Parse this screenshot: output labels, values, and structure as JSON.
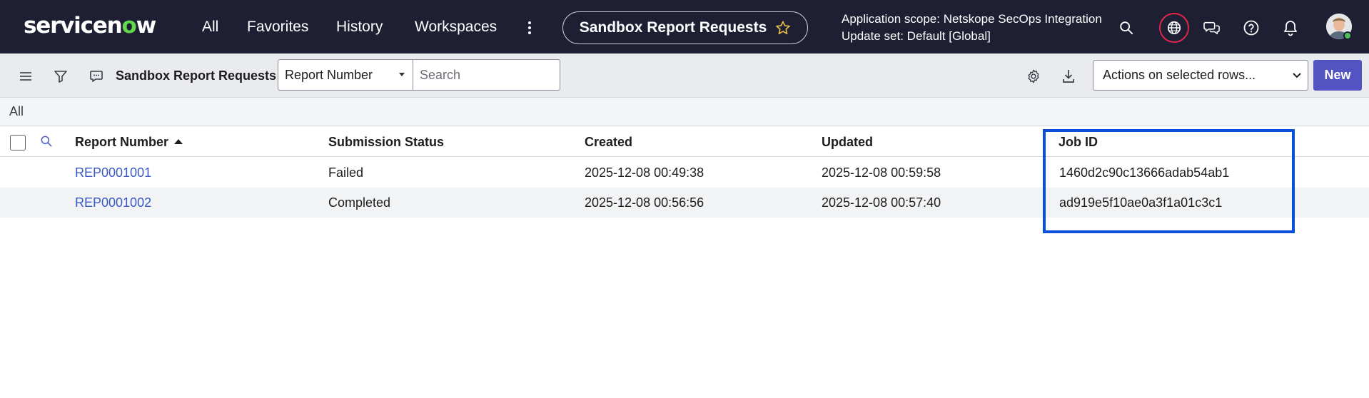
{
  "app": {
    "logo_text_1": "servicen",
    "logo_text_2": "w",
    "logo_mark_letter": "o"
  },
  "nav": {
    "items": [
      "All",
      "Favorites",
      "History",
      "Workspaces"
    ],
    "title": "Sandbox Report Requests",
    "scope_line1": "Application scope: Netskope SecOps Integration",
    "scope_line2": "Update set: Default [Global]"
  },
  "toolbar": {
    "list_title": "Sandbox Report Requests",
    "field_select_value": "Report Number",
    "search_placeholder": "Search",
    "actions_select_value": "Actions on selected rows...",
    "new_label": "New"
  },
  "breadcrumb": {
    "label": "All"
  },
  "table": {
    "columns": [
      "Report Number",
      "Submission Status",
      "Created",
      "Updated",
      "Job ID"
    ],
    "sorted_column": "Report Number",
    "sort_direction": "ascending",
    "rows": [
      {
        "report_number": "REP0001001",
        "submission_status": "Failed",
        "created": "2025-12-08 00:49:38",
        "updated": "2025-12-08 00:59:58",
        "job_id": "1460d2c90c13666adab54ab1"
      },
      {
        "report_number": "REP0001002",
        "submission_status": "Completed",
        "created": "2025-12-08 00:56:56",
        "updated": "2025-12-08 00:57:40",
        "job_id": "ad919e5f10ae0a3f1a01c3c1"
      }
    ]
  },
  "colors": {
    "topbar_bg": "#1e1f33",
    "accent_green": "#62d84e",
    "new_button": "#5353c2",
    "link": "#3a58c8",
    "highlight": "#0a4fd9",
    "star": "#e8c24a",
    "globe_ring": "#e0264b"
  },
  "icons": {
    "more": "vertical-ellipsis-icon",
    "favorite": "star-icon",
    "search": "search-icon",
    "scope": "globe-icon",
    "chat": "chat-bubbles-icon",
    "help": "help-circle-icon",
    "notifications": "bell-icon",
    "menu": "hamburger-icon",
    "filter": "funnel-icon",
    "context": "chat-menu-icon",
    "settings": "gear-icon",
    "download": "download-icon"
  }
}
